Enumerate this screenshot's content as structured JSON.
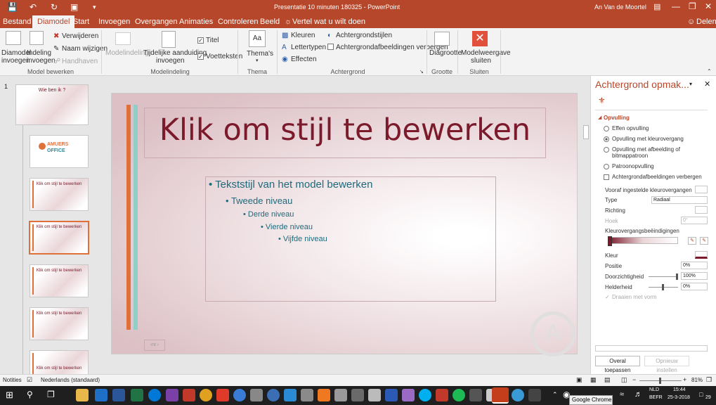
{
  "window": {
    "title": "Presentatie 10 minuten 180325 - PowerPoint",
    "user": "An Van de Moortel"
  },
  "tabs": [
    {
      "label": "Bestand"
    },
    {
      "label": "Diamodel"
    },
    {
      "label": "Start"
    },
    {
      "label": "Invoegen"
    },
    {
      "label": "Overgangen"
    },
    {
      "label": "Animaties"
    },
    {
      "label": "Controleren"
    },
    {
      "label": "Beeld"
    }
  ],
  "tell_me": "Vertel wat u wilt doen",
  "share": "Delen",
  "ribbon": {
    "g1": {
      "insert_slide_master": [
        "Diamodel",
        "invoegen"
      ],
      "insert_layout": [
        "Indeling",
        "invoegen"
      ],
      "delete": "Verwijderen",
      "rename": "Naam wijzigen",
      "preserve": "Handhaven",
      "label": "Model bewerken"
    },
    "g2": {
      "layout_master": "Modelindeling",
      "insert_placeholder": [
        "Tijdelijke aanduiding",
        "invoegen"
      ],
      "title_chk": "Titel",
      "footers_chk": "Voetteksten",
      "label": "Modelindeling"
    },
    "g3": {
      "themes": "Thema's",
      "label": "Thema bewerken"
    },
    "g4": {
      "colors": "Kleuren",
      "fonts": "Lettertypen",
      "effects": "Effecten",
      "bg_styles": "Achtergrondstijlen",
      "hide_bg": "Achtergrondafbeeldingen verbergen",
      "label": "Achtergrond"
    },
    "g5": {
      "slide_size": "Diagrootte",
      "label": "Grootte"
    },
    "g6": {
      "close": [
        "Modelweergave",
        "sluiten"
      ],
      "label": "Sluiten"
    }
  },
  "thumbs": {
    "num": "1",
    "master_title": "Wie ben ik ?",
    "logo_top": "AMUERS",
    "logo_bottom": "OFFICE",
    "layout_title": "Klik om stijl te bewerken"
  },
  "slide": {
    "title": "Klik om stijl te bewerken",
    "levels": [
      "Tekststijl van het model bewerken",
      "Tweede niveau",
      "Derde niveau",
      "Vierde niveau",
      "Vijfde niveau"
    ],
    "footer_num": "‹nr.›"
  },
  "pane": {
    "title": "Achtergrond opmak...",
    "section": "Opvulling",
    "fills": [
      "Effen opvulling",
      "Opvulling met kleurovergang",
      "Opvulling met afbeelding of bitmappatroon",
      "Patroonopvulling"
    ],
    "hide_bg": "Achtergrondafbeeldingen verbergen",
    "preset": "Vooraf ingestelde kleurovergangen",
    "type_label": "Type",
    "type_value": "Radiaal",
    "direction": "Richting",
    "angle_label": "Hoek",
    "angle_value": "0°",
    "stops_label": "Kleurovergangsbeëindigingen",
    "color": "Kleur",
    "position_label": "Positie",
    "position_value": "0%",
    "transparency_label": "Doorzichtigheid",
    "transparency_value": "100%",
    "brightness_label": "Helderheid",
    "brightness_value": "0%",
    "rotate": "Draaien met vorm",
    "apply_all": "Overal toepassen",
    "reset": "Opnieuw instellen"
  },
  "status": {
    "notes": "Notities",
    "language": "Nederlands (standaard)",
    "zoom": "81%"
  },
  "taskbar": {
    "tooltip": "Google Chrome",
    "lang1": "NLD",
    "lang2": "BEFR",
    "time": "15:44",
    "date": "25-3-2018",
    "notif": "29"
  },
  "colors": {
    "accent": "#b7472a",
    "slide_title": "#7a1a2b",
    "body_text": "#1f6a7a",
    "bar_orange": "#e0703a",
    "bar_teal": "#8fcfc8"
  }
}
